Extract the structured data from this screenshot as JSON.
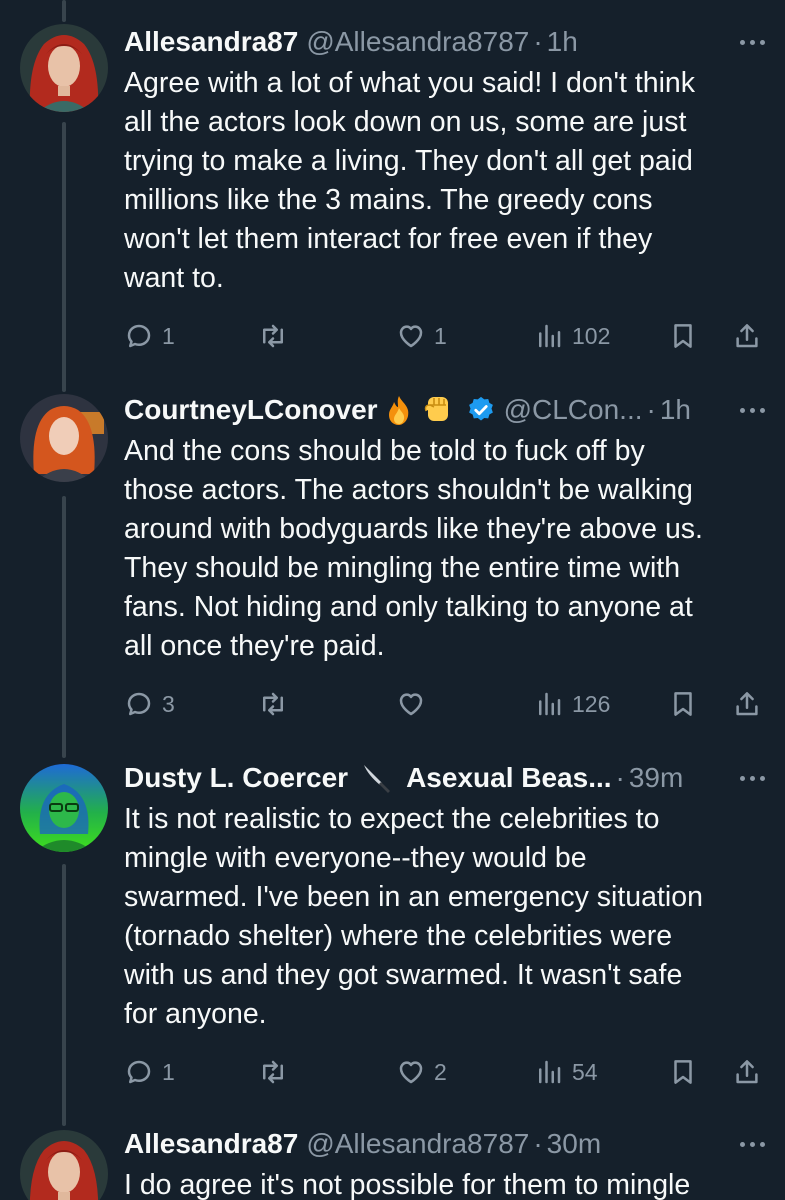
{
  "tweets": [
    {
      "display_name": "Allesandra87",
      "handle": "@Allesandra8787",
      "separator": "·",
      "time": "1h",
      "text": "Agree with a lot of what you said! I don't think\nall the actors look down on us, some are just\ntrying to make a living. They don't all get paid\nmillions like the 3 mains. The greedy cons\nwon't let them interact for free even if they\nwant to.",
      "replies": "1",
      "retweets": "",
      "likes": "1",
      "views": "102"
    },
    {
      "display_name": "CourtneyLConover",
      "handle": "@CLCon...",
      "separator": "·",
      "time": "1h",
      "verified": true,
      "emojis": [
        "fire-emoji",
        "raised-fist-emoji"
      ],
      "text": "And the cons should be told to fuck off by\nthose actors. The actors shouldn't be walking\naround with bodyguards like they're above us.\nThey should be mingling the entire time with\nfans.  Not hiding and only talking to anyone at\nall once they're paid.",
      "replies": "3",
      "retweets": "",
      "likes": "",
      "views": "126"
    },
    {
      "display_name": "Dusty L. Coercer",
      "display_name_suffix": "Asexual Beas...",
      "handle": "",
      "separator": "·",
      "time": "39m",
      "emojis": [
        "knife-emoji"
      ],
      "text": "It is not realistic to expect the celebrities to\nmingle with everyone--they would be\nswarmed. I've been in an emergency situation\n(tornado shelter) where the celebrities were\nwith us and they got swarmed. It wasn't safe\nfor anyone.",
      "replies": "1",
      "retweets": "",
      "likes": "2",
      "views": "54"
    },
    {
      "display_name": "Allesandra87",
      "handle": "@Allesandra8787",
      "separator": "·",
      "time": "30m",
      "text": "I do agree it's not possible for them to mingle"
    }
  ],
  "colors": {
    "background": "#15202b",
    "text": "#f7f9f9",
    "secondary": "#8b98a5",
    "thread_line": "#38444d",
    "verified": "#1d9bf0"
  }
}
